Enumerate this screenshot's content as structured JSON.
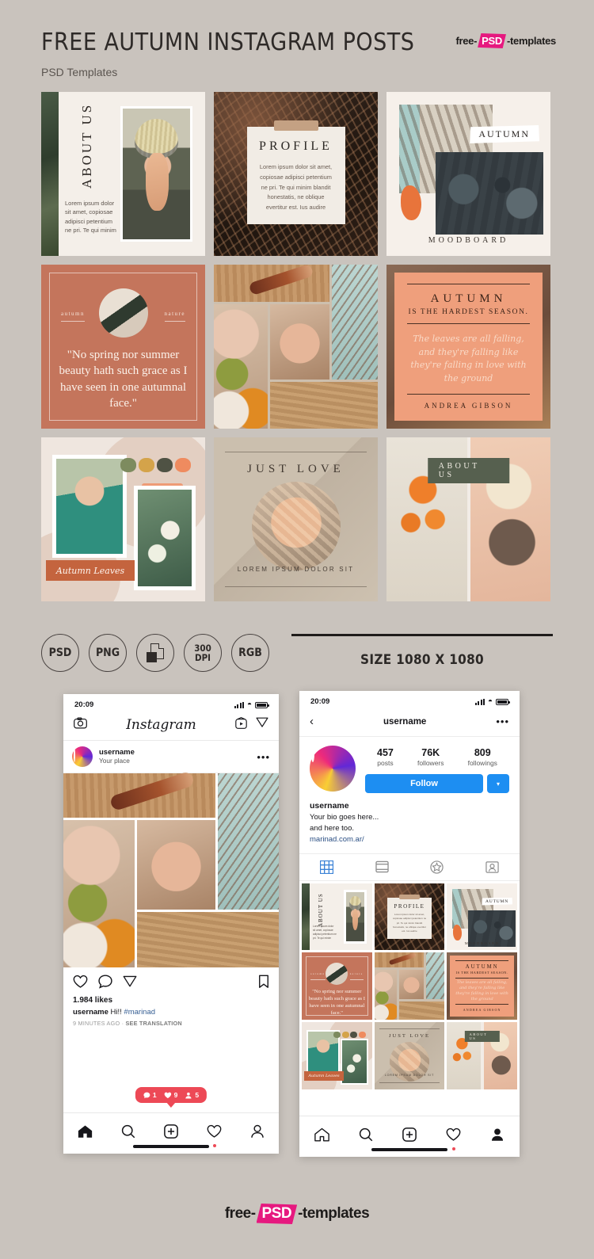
{
  "header": {
    "title": "FREE AUTUMN INSTAGRAM POSTS",
    "subtitle": "PSD Templates",
    "logo": {
      "pre": "free-",
      "mid": "PSD",
      "post": "-templates"
    }
  },
  "templates": [
    {
      "id": "about-us-portrait",
      "vertical_title": "ABOUT US",
      "body": "Lorem ipsum dolor sit amet, copiosae adipisci petentium ne pri. Te qui minim"
    },
    {
      "id": "profile-note",
      "title": "PROFILE",
      "body": "Lorem ipsum dolor sit amet, copiosae adipisci petentium ne pri. Te qui minim blandit honestatis, ne oblique evertitur est. Ius audire"
    },
    {
      "id": "moodboard",
      "tag": "AUTUMN",
      "label": "MOODBOARD"
    },
    {
      "id": "autumn-quote",
      "tag_left": "autumn",
      "tag_right": "nature",
      "quote": "\"No spring nor summer beauty hath such grace as I have seen in one autumnal face.\""
    },
    {
      "id": "photo-collage"
    },
    {
      "id": "hardest-season",
      "title": "AUTUMN",
      "subtitle": "IS THE HARDEST SEASON.",
      "script": "The leaves are all falling, and they're falling like they're falling in love with the ground",
      "author": "ANDREA GIBSON"
    },
    {
      "id": "autumn-leaves",
      "banner": "Autumn Leaves",
      "swatches": [
        "#7d8b5f",
        "#d4a34a",
        "#4f5244",
        "#ef8b5f"
      ]
    },
    {
      "id": "just-love",
      "title": "JUST LOVE",
      "subtitle": "LOREM IPSUM DOLOR SIT"
    },
    {
      "id": "about-us-duo",
      "badge": "ABOUT US"
    }
  ],
  "badges": [
    {
      "label": "PSD",
      "type": "text"
    },
    {
      "label": "PNG",
      "type": "text"
    },
    {
      "label": "layers",
      "type": "icon"
    },
    {
      "label": "300\nDPI",
      "line1": "300",
      "line2": "DPI",
      "type": "two-line"
    },
    {
      "label": "RGB",
      "type": "text"
    }
  ],
  "size_note": "SIZE 1080 X 1080",
  "phone_feed": {
    "status": {
      "time": "20:09",
      "location_arrow": "location-arrow-icon"
    },
    "topbar": {
      "camera_icon": "camera-icon",
      "logo": "Instagram",
      "igtv_icon": "igtv-icon",
      "direct_icon": "direct-message-icon"
    },
    "post": {
      "username": "username",
      "place": "Your place",
      "more": "•••",
      "likes": "1.984 likes",
      "caption_user": "username",
      "caption_text": "Hi!!",
      "caption_hashtag": "#marinad",
      "time_ago": "9 MINUTES AGO",
      "separator": "·",
      "translate": "SEE TRANSLATION"
    },
    "notification_pill": {
      "comments": "1",
      "likes": "9",
      "follows": "5"
    },
    "tabs": [
      "home-icon",
      "search-icon",
      "add-post-icon",
      "activity-icon",
      "profile-icon"
    ]
  },
  "phone_profile": {
    "status": {
      "time": "20:09"
    },
    "nav": {
      "back": "‹",
      "title": "username",
      "more": "•••"
    },
    "stats": [
      {
        "value": "457",
        "label": "posts"
      },
      {
        "value": "76K",
        "label": "followers"
      },
      {
        "value": "809",
        "label": "followings"
      }
    ],
    "follow_button": "Follow",
    "caret": "▾",
    "bio": {
      "name": "username",
      "line1": "Your bio goes here...",
      "line2": "and here too.",
      "link": "marinad.com.ar/"
    },
    "tabs": [
      "grid-icon",
      "collection-icon",
      "star-icon",
      "tagged-icon"
    ],
    "tabs_active_index": 0,
    "grid_labels": [
      "ABOUT US",
      "PROFILE",
      "AUTUMN",
      "quote",
      "collage",
      "AUTUMN",
      "Autumn Leaves",
      "JUST LOVE",
      "ABOUT US"
    ],
    "bottom_tabs": [
      "home-icon",
      "search-icon",
      "add-post-icon",
      "activity-icon",
      "profile-icon"
    ]
  },
  "footer_logo": {
    "pre": "free-",
    "mid": "PSD",
    "post": "-templates"
  },
  "colors": {
    "page_bg": "#c9c3bd",
    "terracotta": "#c4755c",
    "peach": "#ef9f7c",
    "brand_pink": "#e6197f",
    "instagram_blue": "#1d8ef2",
    "notification_red": "#ed4956"
  }
}
